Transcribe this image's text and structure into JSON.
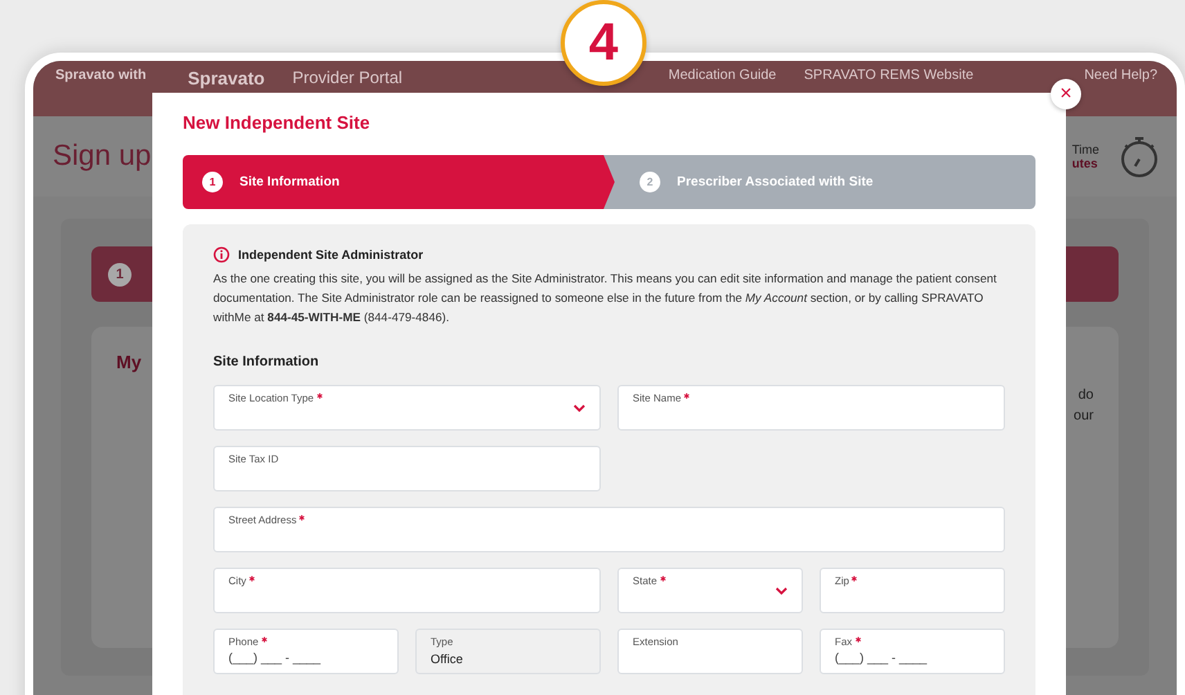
{
  "badge": "4",
  "background": {
    "brand": "Spravato with",
    "logo": "Spravato",
    "portal": "Provider Portal",
    "nav": [
      "Medication Guide",
      "SPRAVATO REMS Website"
    ],
    "help": "Need Help?",
    "page_title": "Sign up",
    "timer_label": "Time",
    "timer_value": "utes",
    "step_number": "1",
    "card_title": "My",
    "card_lines": [
      "do",
      "our"
    ]
  },
  "modal": {
    "title": "New Independent Site",
    "close": "×",
    "steps": [
      {
        "number": "1",
        "label": "Site Information",
        "selected": true
      },
      {
        "number": "2",
        "label": "Prescriber Associated with Site",
        "selected": false
      }
    ],
    "notice": {
      "title": "Independent Site Administrator",
      "text": "As the one creating this site, you will be assigned as the Site Administrator. This means you can edit site information and manage the patient consent documentation. The Site Administrator role can be reassigned to someone else in the future from the *My Account* section, or by calling SPRAVATO withMe at **844-45-WITH-ME** (844-479-4846)."
    },
    "section_title": "Site Information",
    "fields": [
      {
        "label": "Site Location Type",
        "required": true,
        "kind": "select"
      },
      {
        "label": "Site Name",
        "required": true,
        "kind": "text"
      },
      {
        "label": "Site Tax ID",
        "required": false,
        "kind": "text"
      },
      {
        "label": "Street Address",
        "required": true,
        "kind": "text"
      },
      {
        "label": "City",
        "required": true,
        "kind": "text"
      },
      {
        "label": "State",
        "required": true,
        "kind": "select"
      },
      {
        "label": "Zip",
        "required": true,
        "kind": "text"
      },
      {
        "label": "Phone",
        "required": true,
        "kind": "text",
        "placeholder": "(___) ___ - ____"
      },
      {
        "label": "Type",
        "required": false,
        "kind": "readonly",
        "value": "Office"
      },
      {
        "label": "Extension",
        "required": false,
        "kind": "text"
      },
      {
        "label": "Fax",
        "required": true,
        "kind": "text",
        "placeholder": "(___) ___ - ____"
      }
    ]
  }
}
